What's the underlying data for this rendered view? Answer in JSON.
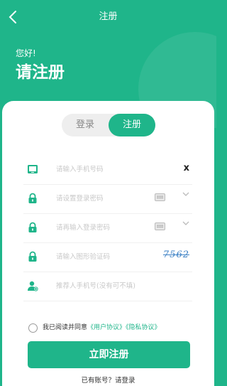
{
  "nav": {
    "back_icon": "chevron-left-icon",
    "title": "注册"
  },
  "header": {
    "greeting": "您好!",
    "title": "请注册"
  },
  "tabs": {
    "login": "登录",
    "register": "注册"
  },
  "form": {
    "phone_placeholder": "请输入手机号码",
    "phone_clear": "x",
    "password_placeholder": "请设置登录密码",
    "confirm_placeholder": "请再输入登录密码",
    "captcha_placeholder": "请输入图形验证码",
    "captcha_text": "7562",
    "referrer_placeholder": "推荐人手机号(没有可不填)"
  },
  "agreement": {
    "text": "我已阅读并同意",
    "user_agreement": "《用户协议》",
    "privacy_policy": "《隐私协议》"
  },
  "submit_label": "立即注册",
  "footer_text": "已有账号？请登录",
  "colors": {
    "accent": "#1fb58a"
  }
}
